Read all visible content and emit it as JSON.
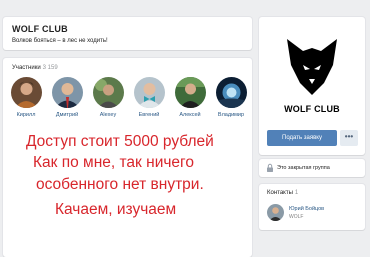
{
  "group": {
    "name": "WOLF CLUB",
    "status": "Волков бояться – в лес не ходить!"
  },
  "members": {
    "title": "Участники",
    "count": "3 159",
    "items": [
      {
        "name": "Кирилл"
      },
      {
        "name": "Дмитрий"
      },
      {
        "name": "Alexey"
      },
      {
        "name": "Евгений"
      },
      {
        "name": "Алексей"
      },
      {
        "name": "Владимир"
      }
    ]
  },
  "overlay": {
    "line1": "Доступ стоит 5000 рублей",
    "line2": "Как по мне, так ничего",
    "line3": "особенного нет внутри.",
    "line4": "Качаем, изучаем"
  },
  "logo": {
    "text": "WOLF CLUB"
  },
  "actions": {
    "apply_label": "Подать заявку",
    "more_label": "•••"
  },
  "privacy": {
    "text": "Это закрытая группа"
  },
  "contacts": {
    "title": "Контакты",
    "count": "1",
    "name": "Юрий Бойцов",
    "role": "WOLF"
  },
  "colors": {
    "accent": "#5181b8",
    "link": "#2a5885",
    "overlay_red": "#d8262c",
    "background": "#edeef0"
  }
}
